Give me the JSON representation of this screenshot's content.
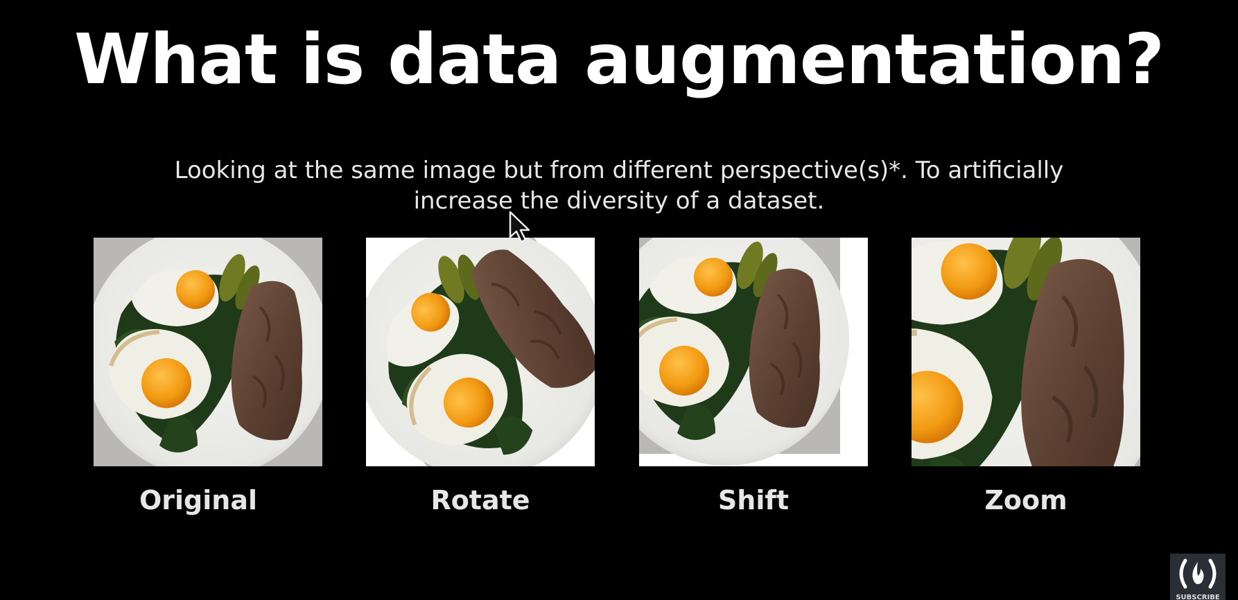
{
  "slide": {
    "title": "What is data augmentation?",
    "subtitle": "Looking at the same image but from different perspective(s)*. To artificially increase the diversity of a dataset."
  },
  "panels": [
    {
      "caption": "Original"
    },
    {
      "caption": "Rotate"
    },
    {
      "caption": "Shift"
    },
    {
      "caption": "Zoom"
    }
  ],
  "watermark": {
    "label": "SUBSCRIBE"
  }
}
